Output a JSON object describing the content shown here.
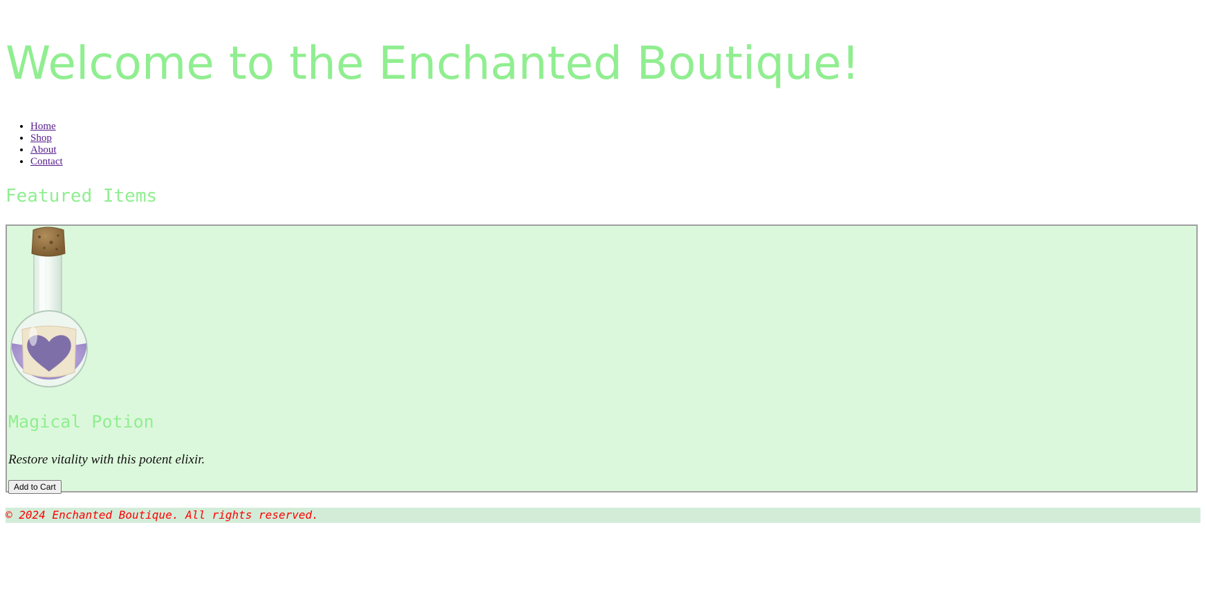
{
  "header": {
    "title": "Welcome to the Enchanted Boutique!"
  },
  "nav": {
    "items": [
      {
        "label": "Home"
      },
      {
        "label": "Shop"
      },
      {
        "label": "About"
      },
      {
        "label": "Contact"
      }
    ]
  },
  "featured": {
    "heading": "Featured Items",
    "products": [
      {
        "name": "Magical Potion",
        "description": "Restore vitality with this potent elixir.",
        "button_label": "Add to Cart",
        "image_icon": "potion-bottle-heart-icon"
      }
    ]
  },
  "footer": {
    "text": "© 2024 Enchanted Boutique. All rights reserved."
  },
  "colors": {
    "heading_green": "#90ee90",
    "card_background": "#dcf8dc",
    "footer_background": "#d2ecd8",
    "footer_text": "#ff0000",
    "link": "#551a8b"
  }
}
